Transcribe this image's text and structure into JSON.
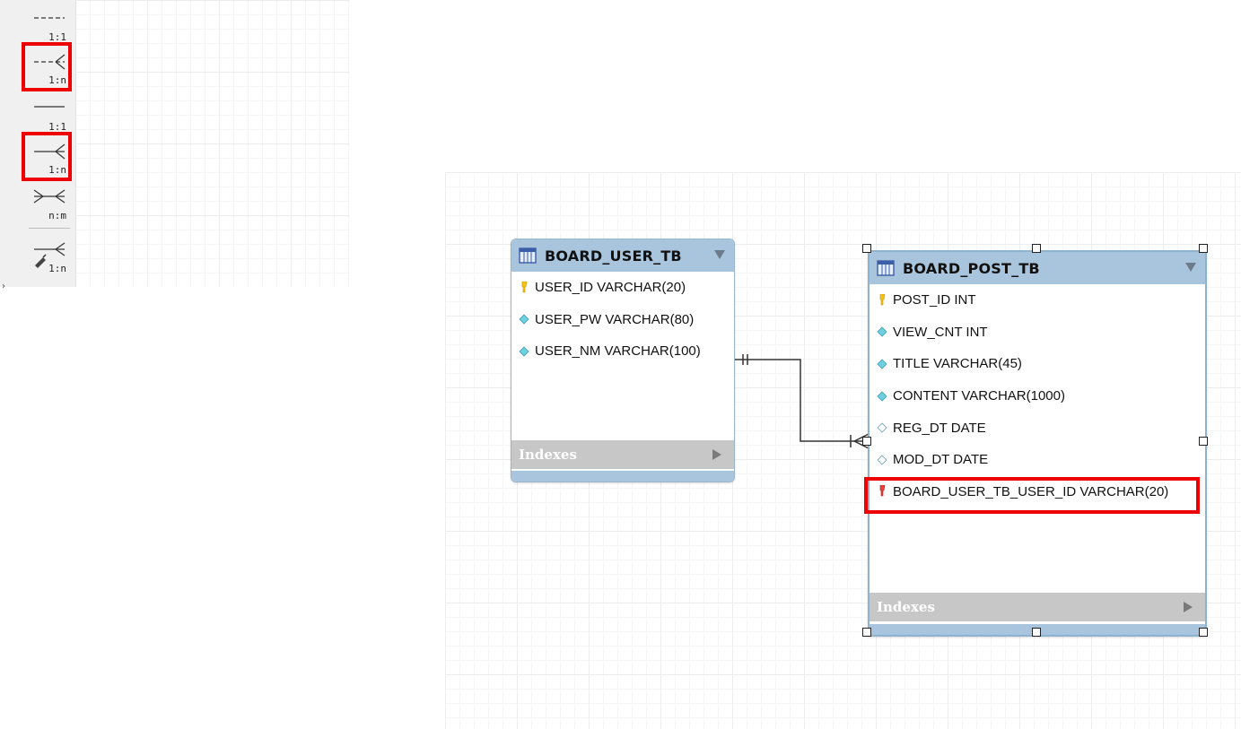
{
  "palette": {
    "tools": [
      {
        "label": "1:1",
        "kind": "dashed-one-to-one",
        "highlighted": false
      },
      {
        "label": "1:n",
        "kind": "dashed-one-to-many",
        "highlighted": true
      },
      {
        "label": "1:1",
        "kind": "solid-one-to-one",
        "highlighted": false
      },
      {
        "label": "1:n",
        "kind": "solid-one-to-many",
        "highlighted": true
      },
      {
        "label": "n:m",
        "kind": "many-to-many",
        "highlighted": false
      },
      {
        "label": "1:n",
        "kind": "existing-columns-one-to-many",
        "highlighted": false
      }
    ]
  },
  "diagram": {
    "tables": [
      {
        "name": "BOARD_USER_TB",
        "columns": [
          {
            "text": "USER_ID VARCHAR(20)",
            "icon": "primary-key-icon"
          },
          {
            "text": "USER_PW VARCHAR(80)",
            "icon": "column-diamond-icon"
          },
          {
            "text": "USER_NM VARCHAR(100)",
            "icon": "column-diamond-icon"
          }
        ],
        "indexes_label": "Indexes"
      },
      {
        "name": "BOARD_POST_TB",
        "columns": [
          {
            "text": "POST_ID INT",
            "icon": "primary-key-icon"
          },
          {
            "text": "VIEW_CNT INT",
            "icon": "column-diamond-icon"
          },
          {
            "text": "TITLE VARCHAR(45)",
            "icon": "column-diamond-icon"
          },
          {
            "text": "CONTENT VARCHAR(1000)",
            "icon": "column-diamond-icon"
          },
          {
            "text": "REG_DT DATE",
            "icon": "nullable-diamond-icon"
          },
          {
            "text": "MOD_DT DATE",
            "icon": "nullable-diamond-icon"
          },
          {
            "text": "BOARD_USER_TB_USER_ID VARCHAR(20)",
            "icon": "foreign-key-icon"
          }
        ],
        "indexes_label": "Indexes"
      }
    ],
    "relationship": {
      "from": "BOARD_USER_TB",
      "to": "BOARD_POST_TB",
      "cardinality": "1:n"
    },
    "colors": {
      "header": "#a9c5de",
      "highlight": "#ee0000",
      "indexes": "#c7c7c7"
    }
  }
}
